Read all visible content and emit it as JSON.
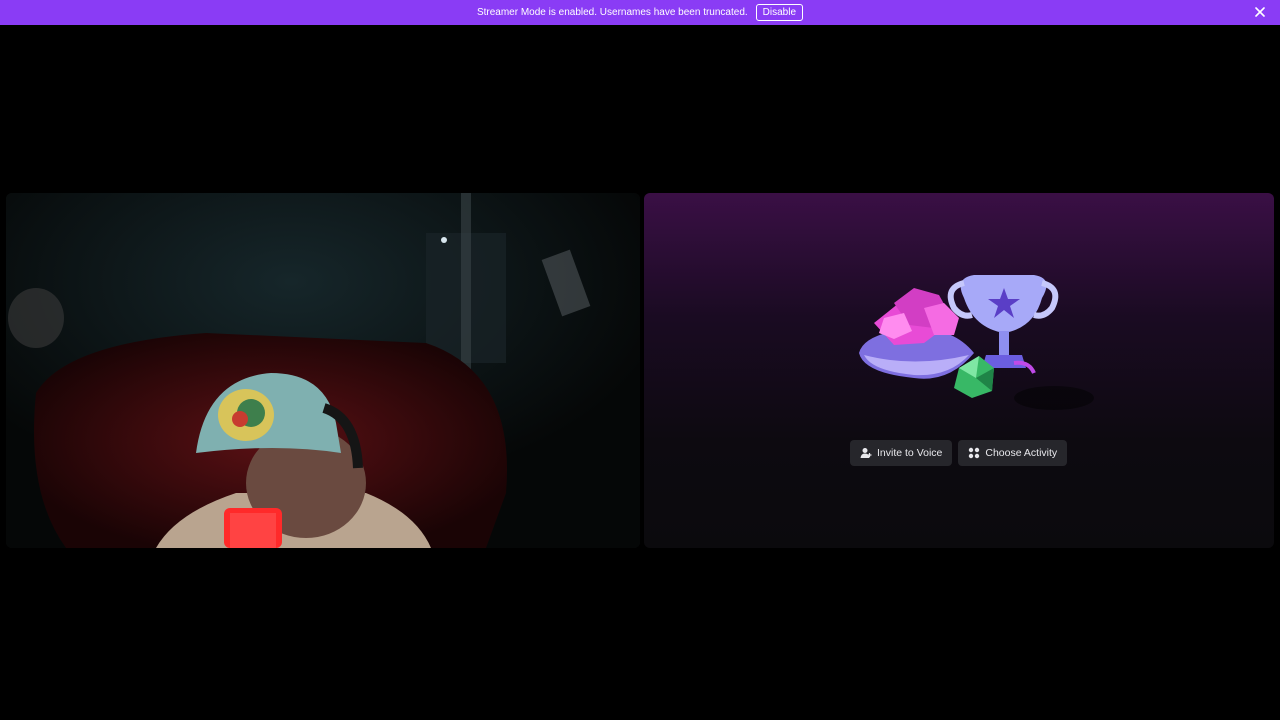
{
  "banner": {
    "message": "Streamer Mode is enabled. Usernames have been truncated.",
    "disable_label": "Disable",
    "close_icon": "close-icon",
    "background": "#8a3cf5"
  },
  "activity_panel": {
    "invite_label": "Invite to Voice",
    "invite_icon": "person-add-icon",
    "activity_label": "Choose Activity",
    "activity_icon": "grid-icon",
    "illustration": "trophy-gems-dice-illustration"
  },
  "video_panel": {
    "content": "webcam-feed"
  }
}
